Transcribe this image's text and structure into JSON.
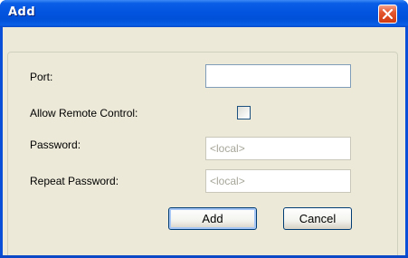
{
  "window": {
    "title": "Add"
  },
  "form": {
    "port_label": "Port:",
    "port_value": "",
    "remote_label": "Allow Remote Control:",
    "remote_checked": false,
    "password_label": "Password:",
    "password_placeholder": "<local>",
    "repeat_label": "Repeat Password:",
    "repeat_placeholder": "<local>"
  },
  "buttons": {
    "add_label": "Add",
    "cancel_label": "Cancel"
  },
  "colors": {
    "titlebar": "#0254e0",
    "dialog_bg": "#ece9d8",
    "close_button": "#e4572e"
  }
}
